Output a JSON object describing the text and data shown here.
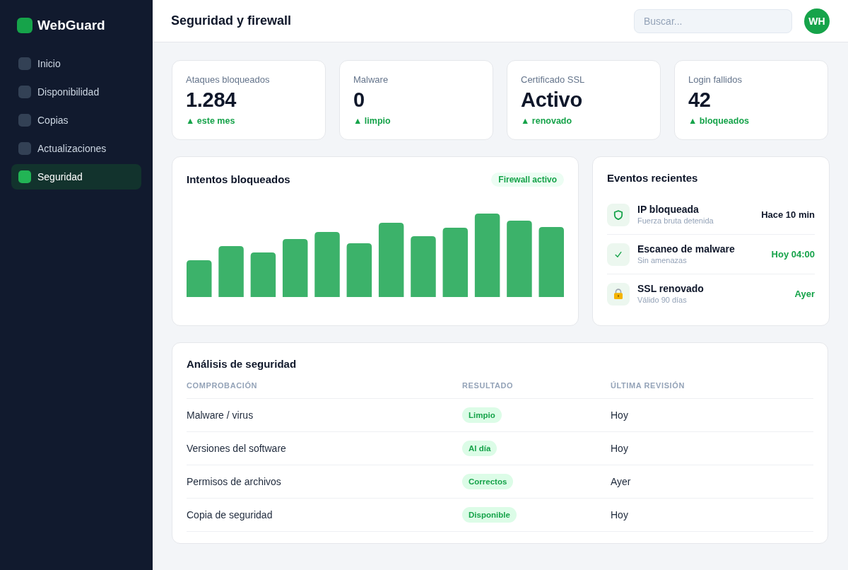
{
  "sidebar": {
    "brand": "WebGuard",
    "items": [
      {
        "label": "Inicio",
        "selected": false
      },
      {
        "label": "Disponibilidad",
        "selected": false
      },
      {
        "label": "Copias",
        "selected": false
      },
      {
        "label": "Actualizaciones",
        "selected": false
      },
      {
        "label": "Seguridad",
        "selected": true
      }
    ]
  },
  "header": {
    "title": "Seguridad y firewall",
    "search": {
      "placeholder": "Buscar..."
    },
    "avatar": "WH"
  },
  "stats": [
    {
      "label": "Ataques bloqueados",
      "value": "1.284",
      "change": "▲ este mes"
    },
    {
      "label": "Malware",
      "value": "0",
      "change": "▲ limpio"
    },
    {
      "label": "Certificado SSL",
      "value": "Activo",
      "change": "▲ renovado"
    },
    {
      "label": "Login fallidos",
      "value": "42",
      "change": "▲ bloqueados"
    }
  ],
  "chart_panel": {
    "title": "Intentos bloqueados",
    "badge": "Firewall activo"
  },
  "events": {
    "title": "Eventos recientes",
    "items": [
      {
        "kind": "block",
        "title": "IP bloqueada",
        "detail": "Fuerza bruta detenida",
        "time": "Hace 10 min",
        "color": "#0f172a"
      },
      {
        "kind": "scan",
        "title": "Escaneo de malware",
        "detail": "Sin amenazas",
        "time": "Hoy 04:00",
        "color": "#16a34a"
      },
      {
        "kind": "ssl",
        "title": "SSL renovado",
        "detail": "Válido 90 días",
        "time": "Ayer",
        "color": "#16a34a"
      }
    ]
  },
  "analysis": {
    "title": "Análisis de seguridad",
    "columns": [
      "COMPROBACIÓN",
      "RESULTADO",
      "ÚLTIMA REVISIÓN"
    ],
    "rows": [
      {
        "check": "Malware / virus",
        "result": "Limpio",
        "last_review": "Hoy"
      },
      {
        "check": "Versiones del software",
        "result": "Al día",
        "last_review": "Hoy"
      },
      {
        "check": "Permisos de archivos",
        "result": "Correctos",
        "last_review": "Ayer"
      },
      {
        "check": "Copia de seguridad",
        "result": "Disponible",
        "last_review": "Hoy"
      }
    ]
  }
}
